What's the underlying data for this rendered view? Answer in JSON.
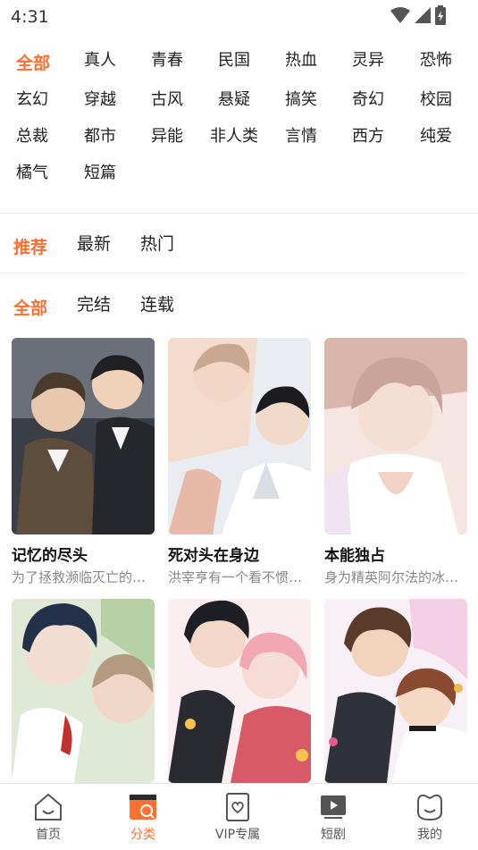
{
  "status": {
    "time": "4:31"
  },
  "genres": {
    "rows": [
      [
        "全部",
        "真人",
        "青春",
        "民国",
        "热血",
        "灵异",
        "恐怖"
      ],
      [
        "玄幻",
        "穿越",
        "古风",
        "悬疑",
        "搞笑",
        "奇幻",
        "校园"
      ],
      [
        "总裁",
        "都市",
        "异能",
        "非人类",
        "言情",
        "西方",
        "纯爱"
      ],
      [
        "橘气",
        "短篇"
      ]
    ],
    "selected": "全部"
  },
  "sort": {
    "options": [
      "推荐",
      "最新",
      "热门"
    ],
    "selected": "推荐"
  },
  "status_filter": {
    "options": [
      "全部",
      "完结",
      "连载"
    ],
    "selected": "全部"
  },
  "comics": [
    {
      "title": "记忆的尽头",
      "desc": "为了拯救濒临灭亡的…"
    },
    {
      "title": "死对头在身边",
      "desc": "洪宰亨有一个看不惯…"
    },
    {
      "title": "本能独占",
      "desc": "身为精英阿尔法的冰…"
    },
    {
      "title": "",
      "desc": ""
    },
    {
      "title": "",
      "desc": ""
    },
    {
      "title": "",
      "desc": ""
    }
  ],
  "tabbar": {
    "items": [
      {
        "label": "首页",
        "icon": "home-icon"
      },
      {
        "label": "分类",
        "icon": "category-icon"
      },
      {
        "label": "VIP专属",
        "icon": "vip-icon"
      },
      {
        "label": "短剧",
        "icon": "video-icon"
      },
      {
        "label": "我的",
        "icon": "profile-icon"
      }
    ],
    "selected": "分类"
  },
  "colors": {
    "accent": "#ff6f2e",
    "text": "#222222",
    "muted": "#888888"
  }
}
